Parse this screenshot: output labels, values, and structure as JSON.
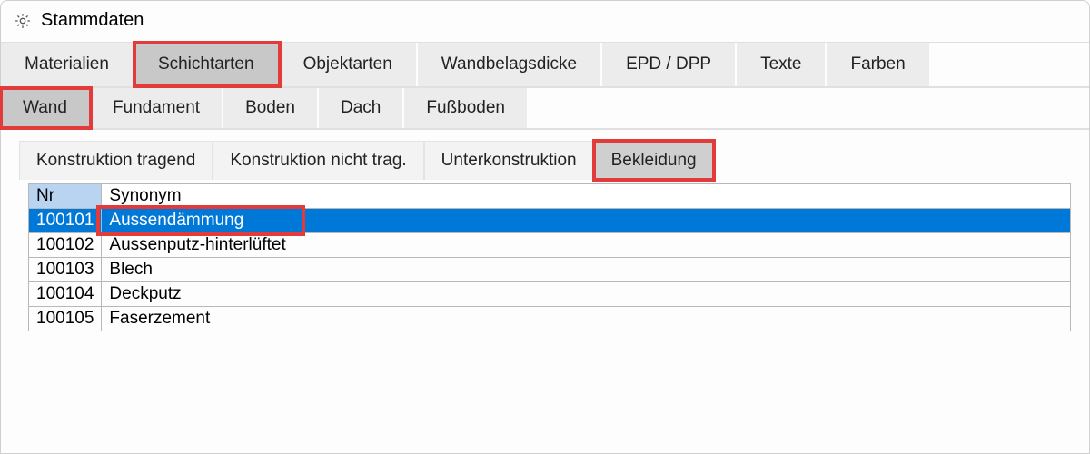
{
  "window": {
    "title": "Stammdaten"
  },
  "tabs_level1": [
    {
      "label": "Materialien",
      "active": false,
      "highlight": false
    },
    {
      "label": "Schichtarten",
      "active": true,
      "highlight": true
    },
    {
      "label": "Objektarten",
      "active": false,
      "highlight": false
    },
    {
      "label": "Wandbelagsdicke",
      "active": false,
      "highlight": false
    },
    {
      "label": "EPD / DPP",
      "active": false,
      "highlight": false
    },
    {
      "label": "Texte",
      "active": false,
      "highlight": false
    },
    {
      "label": "Farben",
      "active": false,
      "highlight": false
    }
  ],
  "tabs_level2": [
    {
      "label": "Wand",
      "active": true,
      "highlight": true
    },
    {
      "label": "Fundament",
      "active": false,
      "highlight": false
    },
    {
      "label": "Boden",
      "active": false,
      "highlight": false
    },
    {
      "label": "Dach",
      "active": false,
      "highlight": false
    },
    {
      "label": "Fußboden",
      "active": false,
      "highlight": false
    }
  ],
  "tabs_level3": [
    {
      "label": "Konstruktion tragend",
      "active": false,
      "highlight": false
    },
    {
      "label": "Konstruktion nicht trag.",
      "active": false,
      "highlight": false
    },
    {
      "label": "Unterkonstruktion",
      "active": false,
      "highlight": false
    },
    {
      "label": "Bekleidung",
      "active": true,
      "highlight": true
    }
  ],
  "table": {
    "headers": {
      "nr": "Nr",
      "synonym": "Synonym"
    },
    "rows": [
      {
        "nr": "100101",
        "synonym": "Aussendämmung",
        "selected": true,
        "cell_highlight": true
      },
      {
        "nr": "100102",
        "synonym": "Aussenputz-hinterlüftet",
        "selected": false,
        "cell_highlight": false
      },
      {
        "nr": "100103",
        "synonym": "Blech",
        "selected": false,
        "cell_highlight": false
      },
      {
        "nr": "100104",
        "synonym": "Deckputz",
        "selected": false,
        "cell_highlight": false
      },
      {
        "nr": "100105",
        "synonym": "Faserzement",
        "selected": false,
        "cell_highlight": false
      }
    ]
  },
  "colors": {
    "highlight_border": "#e23b3b",
    "selection_bg": "#0078d7"
  }
}
